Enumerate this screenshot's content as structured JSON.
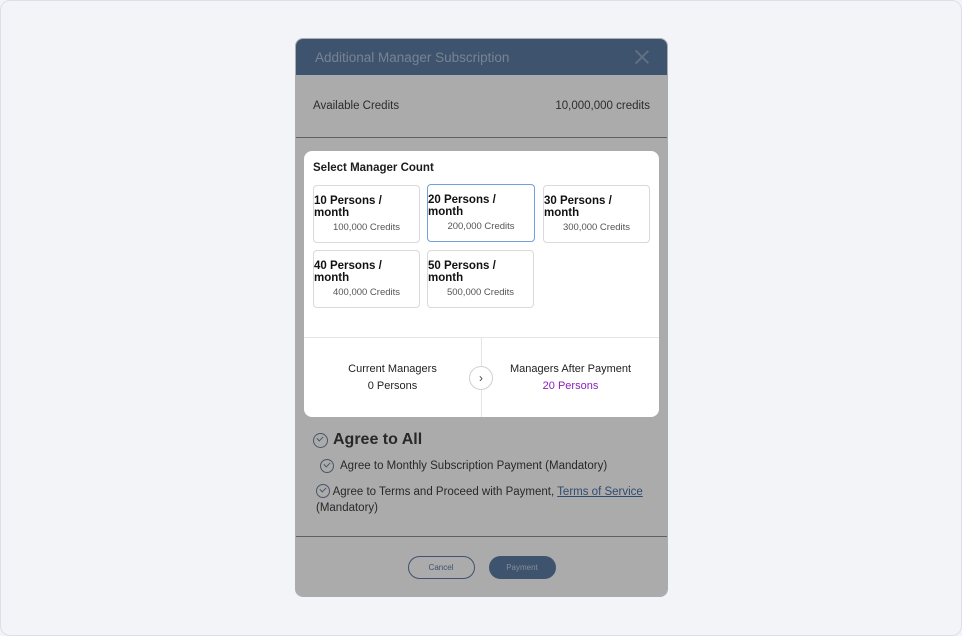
{
  "dialog": {
    "title": "Additional Manager Subscription",
    "credits_label": "Available Credits",
    "credits_value": "10,000,000 credits",
    "agree_all": "Agree to All",
    "agree_monthly": "Agree to Monthly Subscription Payment (Mandatory)",
    "agree_terms_prefix": "Agree to Terms and Proceed with Payment,",
    "agree_terms_link": "Terms of Service",
    "agree_terms_suffix": "(Mandatory)",
    "cancel_label": "Cancel",
    "payment_label": "Payment"
  },
  "panel": {
    "title": "Select Manager Count",
    "options": [
      {
        "title": "10 Persons / month",
        "credits": "100,000 Credits",
        "selected": false
      },
      {
        "title": "20 Persons / month",
        "credits": "200,000 Credits",
        "selected": true
      },
      {
        "title": "30 Persons / month",
        "credits": "300,000 Credits",
        "selected": false
      },
      {
        "title": "40 Persons / month",
        "credits": "400,000 Credits",
        "selected": false
      },
      {
        "title": "50 Persons / month",
        "credits": "500,000 Credits",
        "selected": false
      }
    ],
    "current_label": "Current Managers",
    "current_value": "0 Persons",
    "after_label": "Managers After Payment",
    "after_value": "20 Persons",
    "arrow_glyph": "›"
  },
  "colors": {
    "header": "#5d7ca3",
    "selected_border": "#6fa0d6",
    "accent_value": "#8a1fbf"
  }
}
